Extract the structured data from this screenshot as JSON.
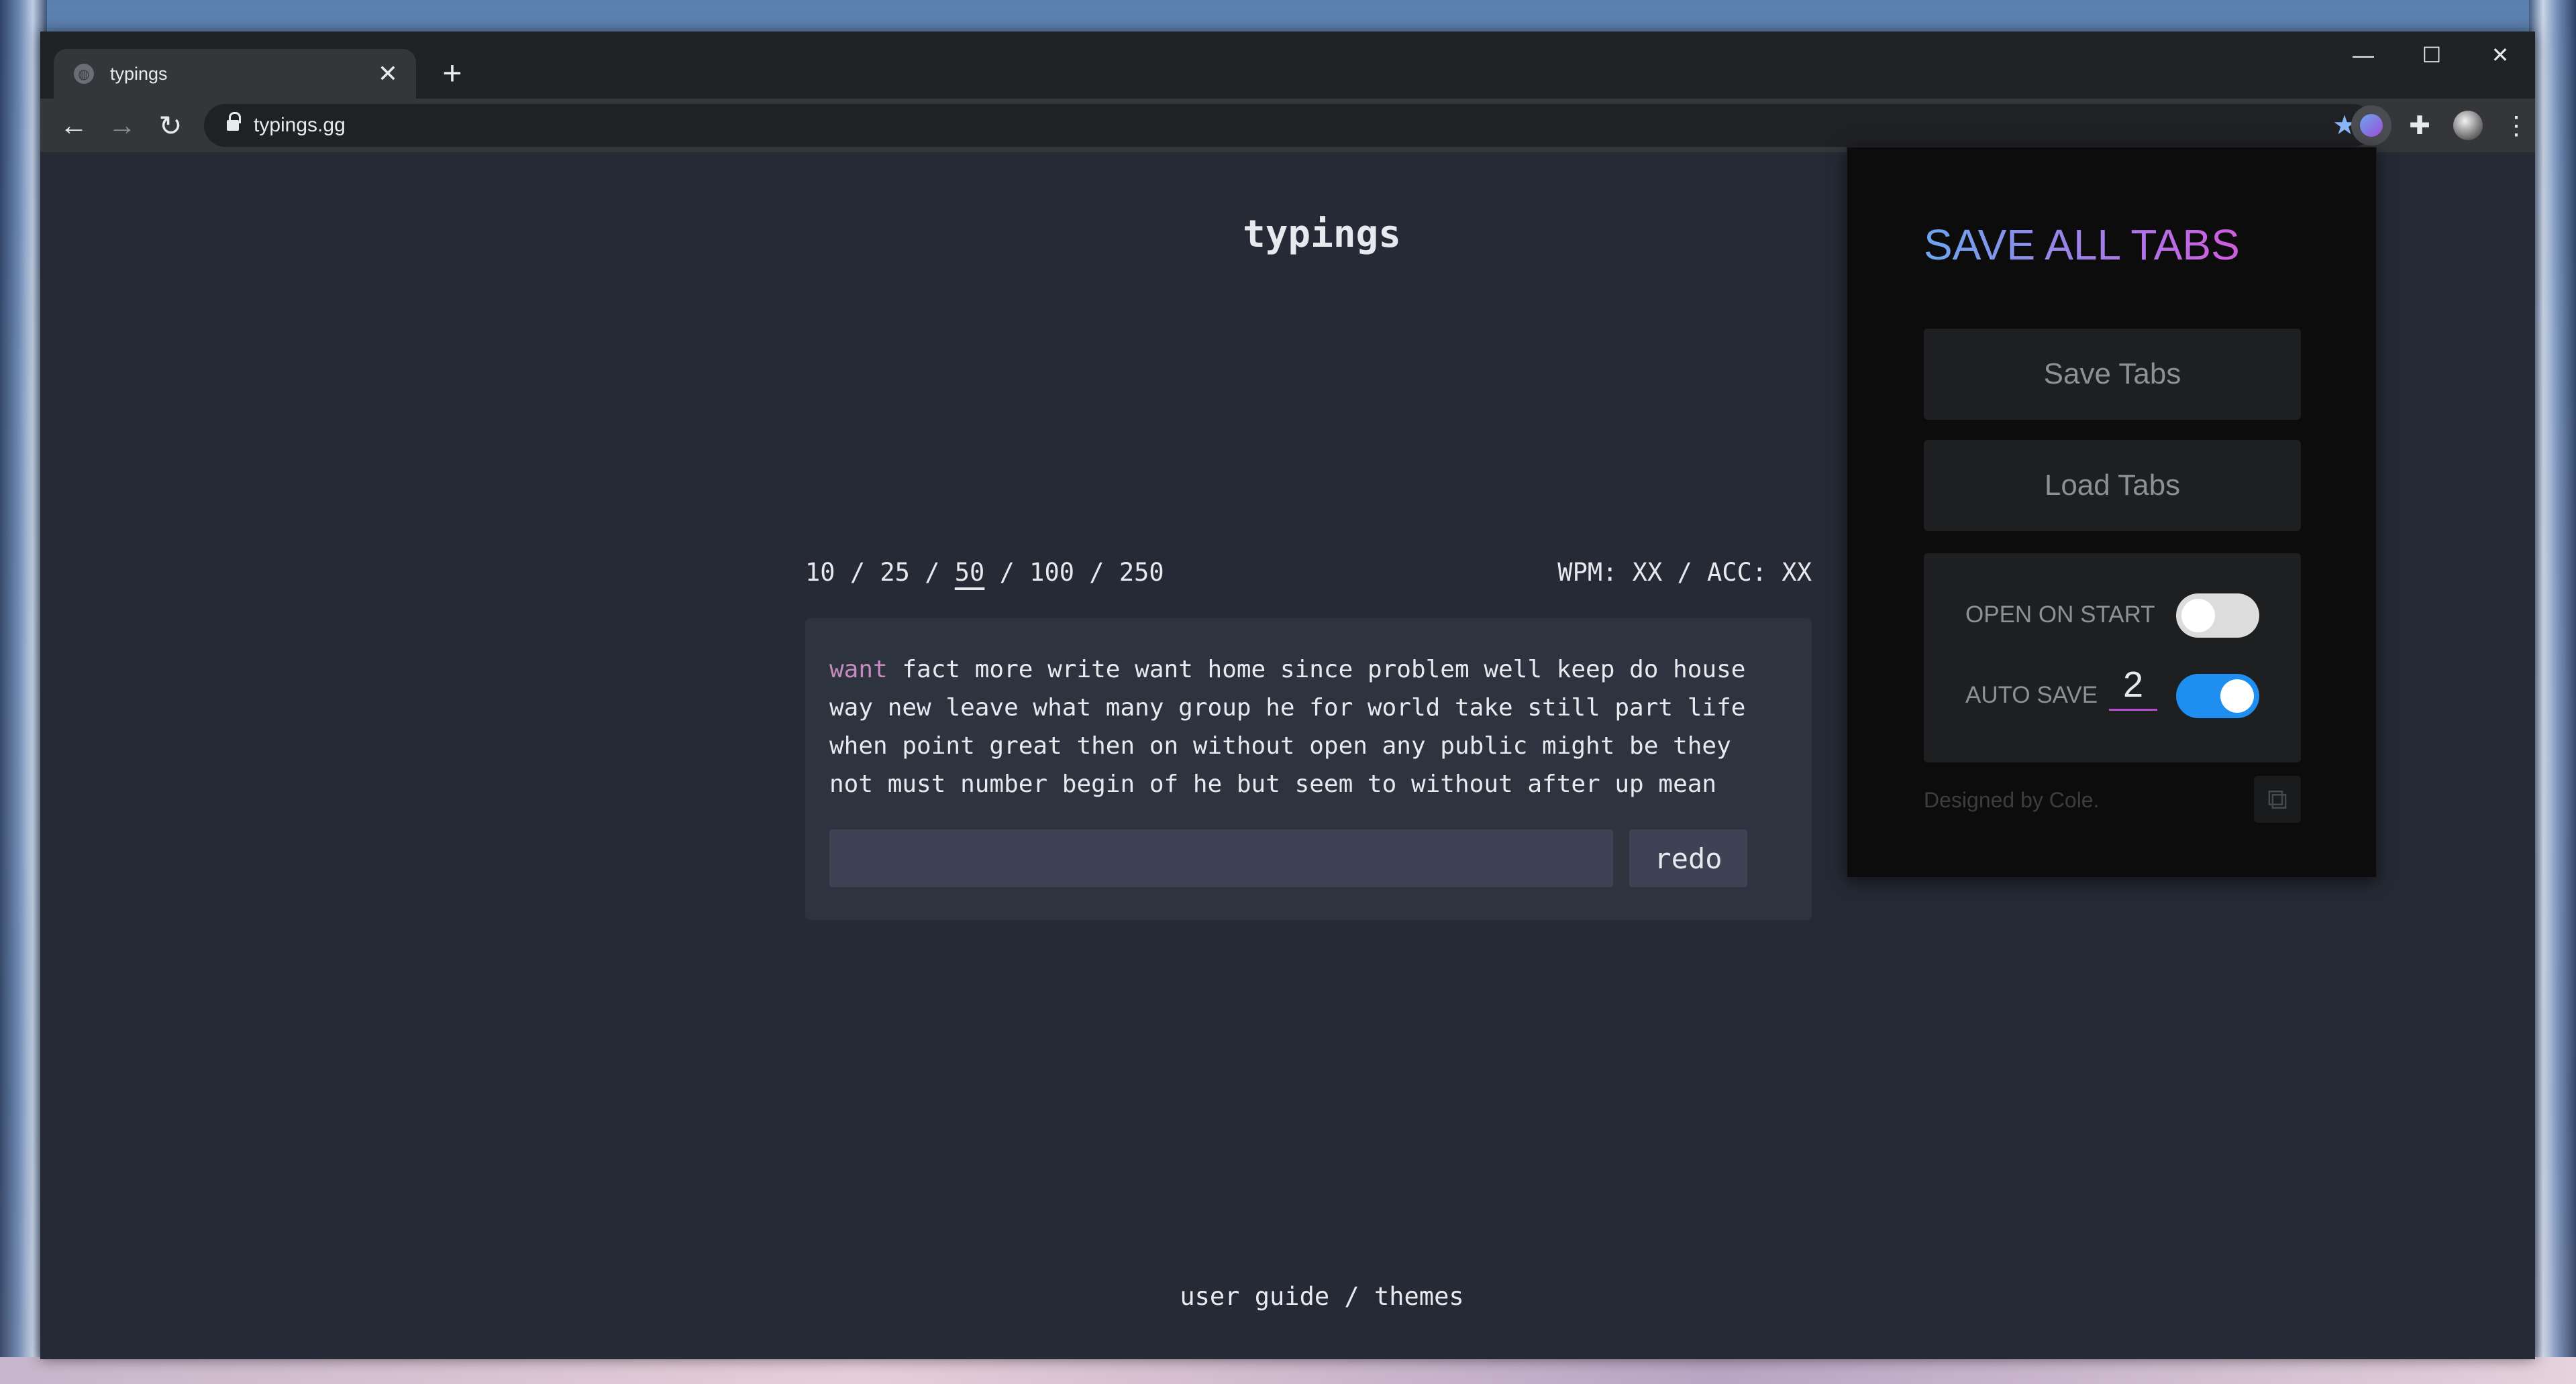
{
  "browser": {
    "tab_title": "typings",
    "new_tab": "+",
    "tab_close": "✕",
    "url": "typings.gg",
    "controls": {
      "minimize": "—",
      "maximize": "☐",
      "close": "✕"
    }
  },
  "site": {
    "title": "typings",
    "word_counts": [
      "10",
      "25",
      "50",
      "100",
      "250"
    ],
    "separator": " / ",
    "selected_count": "50",
    "stats": "WPM: XX / ACC: XX",
    "current_word": "want",
    "words_rest": " fact more write want home since problem well keep do house way new leave what many group he for world take still part life when point great then on without open any public might be they not must number begin of he but seem to without after up mean",
    "redo_label": "redo",
    "footer": {
      "user_guide": "user guide",
      "sep": " / ",
      "themes": "themes"
    }
  },
  "popup": {
    "title": "SAVE ALL TABS",
    "save_label": "Save Tabs",
    "load_label": "Load Tabs",
    "open_on_start_label": "OPEN ON START",
    "open_on_start_enabled": false,
    "auto_save_label": "AUTO SAVE",
    "auto_save_value": "2",
    "auto_save_enabled": true,
    "designed_by": "Designed by Cole."
  },
  "colors": {
    "page_bg": "#252a36",
    "text": "#e8e9ee",
    "current_word": "#c58bbc",
    "toggle_on": "#1e8ff0",
    "title_gradient": [
      "#6aa6f0",
      "#d25be0"
    ]
  }
}
